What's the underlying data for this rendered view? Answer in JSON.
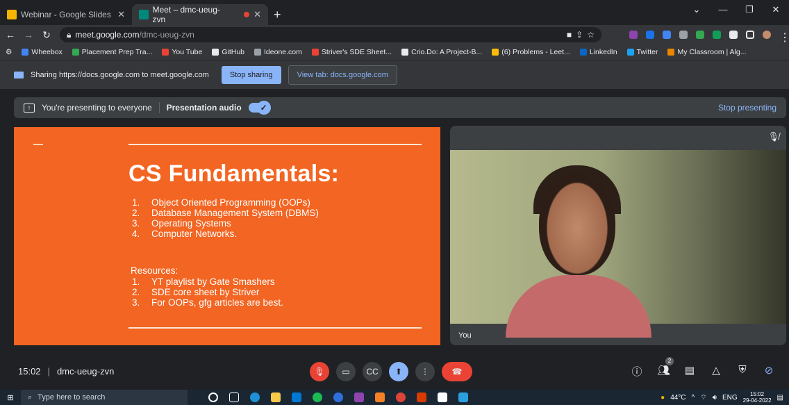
{
  "browser": {
    "tabs": [
      {
        "title": "Webinar - Google Slides",
        "favicon_color": "#f4b400",
        "active": false
      },
      {
        "title": "Meet – dmc-ueug-zvn",
        "favicon_color": "#00897b",
        "active": true
      }
    ],
    "new_tab_label": "+",
    "url_host": "meet.google.com",
    "url_path": "/dmc-ueug-zvn",
    "bookmarks": [
      {
        "label": "Wheebox",
        "color": "#4285f4"
      },
      {
        "label": "Placement Prep Tra...",
        "color": "#34a853"
      },
      {
        "label": "You Tube",
        "color": "#ea4335"
      },
      {
        "label": "GitHub",
        "color": "#e8eaed"
      },
      {
        "label": "Ideone.com",
        "color": "#9aa0a6"
      },
      {
        "label": "Striver's SDE Sheet...",
        "color": "#ea4335"
      },
      {
        "label": "Crio.Do: A Project-B...",
        "color": "#e8eaed"
      },
      {
        "label": "(6) Problems - Leet...",
        "color": "#fbbc04"
      },
      {
        "label": "LinkedIn",
        "color": "#0a66c2"
      },
      {
        "label": "Twitter",
        "color": "#1da1f2"
      },
      {
        "label": "My Classroom | Alg...",
        "color": "#ea8600"
      }
    ]
  },
  "sharing": {
    "message": "Sharing https://docs.google.com to meet.google.com",
    "stop_label": "Stop sharing",
    "view_label": "View tab: docs.google.com"
  },
  "presenting": {
    "message": "You're presenting to everyone",
    "audio_label": "Presentation audio",
    "audio_on": true,
    "stop_label": "Stop presenting"
  },
  "slide": {
    "title": "CS Fundamentals:",
    "topics": [
      {
        "num": "1.",
        "text": "Object Oriented Programming (OOPs)"
      },
      {
        "num": "2.",
        "text": "Database Management System (DBMS)"
      },
      {
        "num": "3.",
        "text": "Operating Systems"
      },
      {
        "num": "4.",
        "text": "Computer Networks."
      }
    ],
    "resources_heading": "Resources:",
    "resources": [
      {
        "num": "1.",
        "text": "YT playlist by Gate Smashers"
      },
      {
        "num": "2.",
        "text": "SDE core sheet by Striver"
      },
      {
        "num": "3.",
        "text": "For OOPs, gfg articles are best."
      }
    ],
    "background": "#f26522"
  },
  "participant": {
    "name": "You",
    "muted": true
  },
  "meeting": {
    "time": "15:02",
    "code": "dmc-ueug-zvn",
    "participant_count": "2"
  },
  "taskbar": {
    "search_placeholder": "Type here to search",
    "weather": "44°C",
    "language": "ENG",
    "time": "15:02",
    "date": "29-04-2022"
  }
}
